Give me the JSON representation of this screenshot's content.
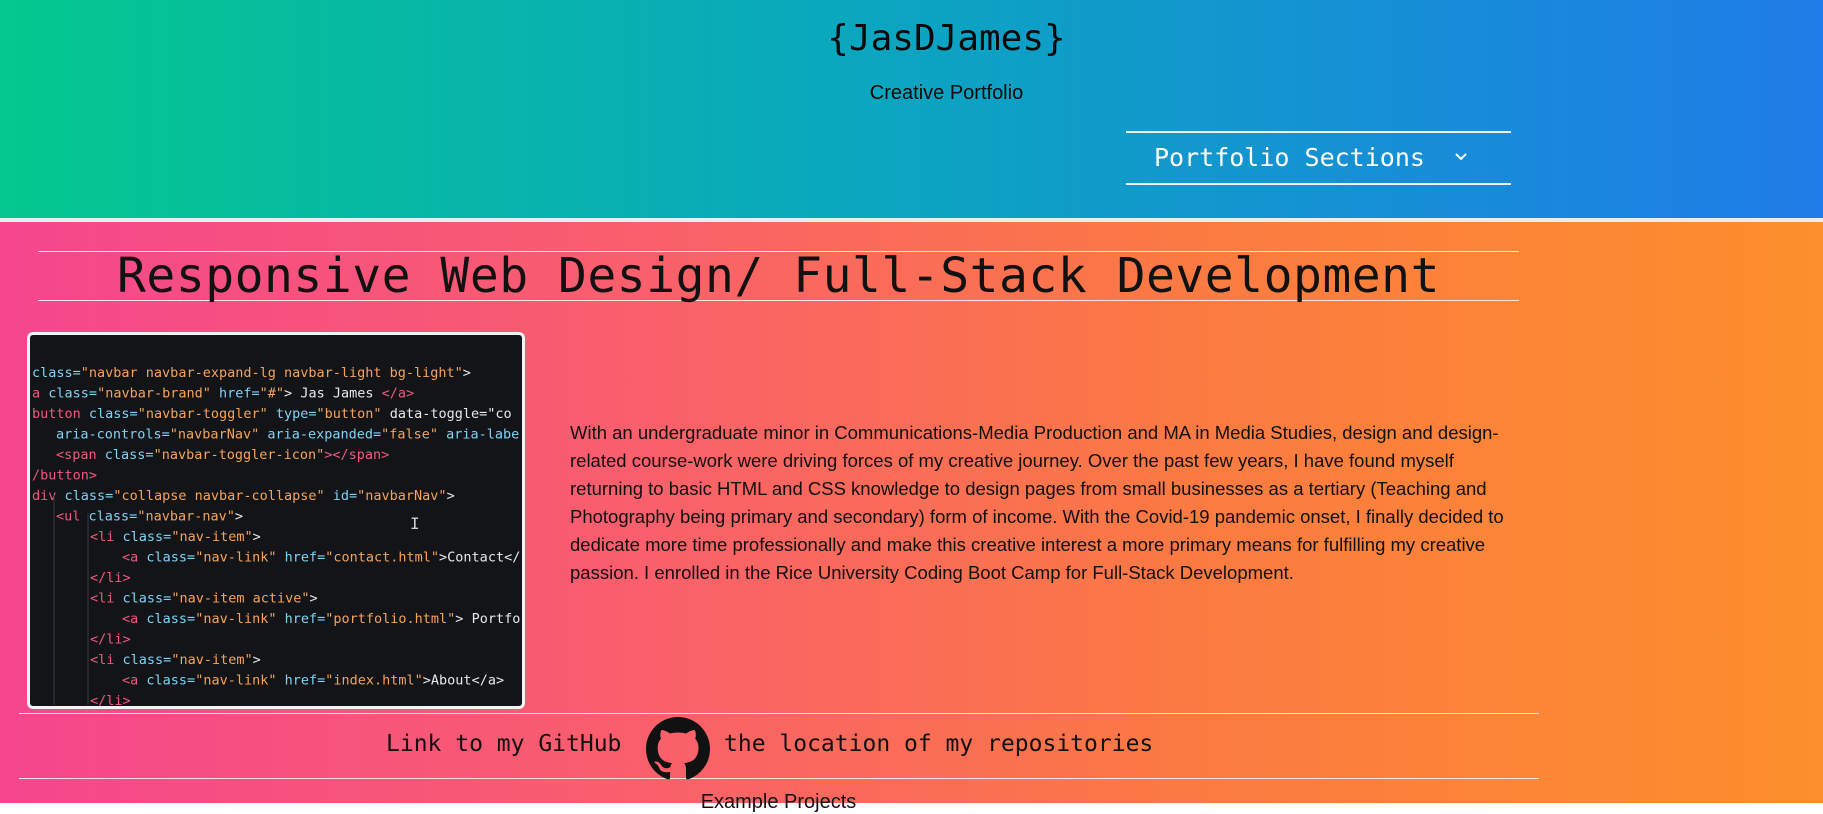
{
  "header": {
    "brand": "{JasDJames}",
    "tagline": "Creative Portfolio",
    "nav_toggle_label": "Portfolio Sections"
  },
  "section": {
    "title": "Responsive Web Design/ Full-Stack Development",
    "description": "With an undergraduate minor in Communications-Media Production and MA in Media Studies, design and design-related course-work were driving forces of my creative journey. Over the past few years, I have found myself returning to basic HTML and CSS knowledge to design pages from small businesses as a tertiary (Teaching and Photography being primary and secondary) form of income. With the Covid-19 pandemic onset, I finally decided to dedicate more time professionally and make this creative interest a more primary means for fulfilling my creative passion. I enrolled in the Rice University Coding Boot Camp for Full-Stack Development."
  },
  "github": {
    "link_text": "Link to my GitHub",
    "tail_text": "the location of my repositories"
  },
  "next_section": {
    "heading": "Example Projects"
  },
  "code_image": {
    "lines": [
      "class=\"navbar navbar-expand-lg navbar-light bg-light\">",
      "a class=\"navbar-brand\" href=\"#\"> Jas James </a>",
      "button class=\"navbar-toggler\" type=\"button\" data-toggle=\"co",
      "aria-controls=\"navbarNav\" aria-expanded=\"false\" aria-labe",
      "<span class=\"navbar-toggler-icon\"></span>",
      "/button>",
      "div class=\"collapse navbar-collapse\" id=\"navbarNav\">",
      "<ul class=\"navbar-nav\">",
      "<li class=\"nav-item\">",
      "<a class=\"nav-link\" href=\"contact.html\">Contact</",
      "</li>",
      "<li class=\"nav-item active\">",
      "<a class=\"nav-link\" href=\"portfolio.html\"> Portfo",
      "</li>",
      "<li class=\"nav-item\">",
      "<a class=\"nav-link\" href=\"index.html\">About</a>",
      "</li>"
    ]
  },
  "colors": {
    "header_gradient": [
      "#04c88e",
      "#0aa8bd",
      "#1f7ce8"
    ],
    "main_gradient": [
      "#f5468e",
      "#f95f6c",
      "#fb7a42",
      "#fd8f2c"
    ],
    "rule": "#fbe5e5"
  },
  "icons": {
    "nav_toggle": "chevron-down-icon",
    "github": "github-icon"
  }
}
